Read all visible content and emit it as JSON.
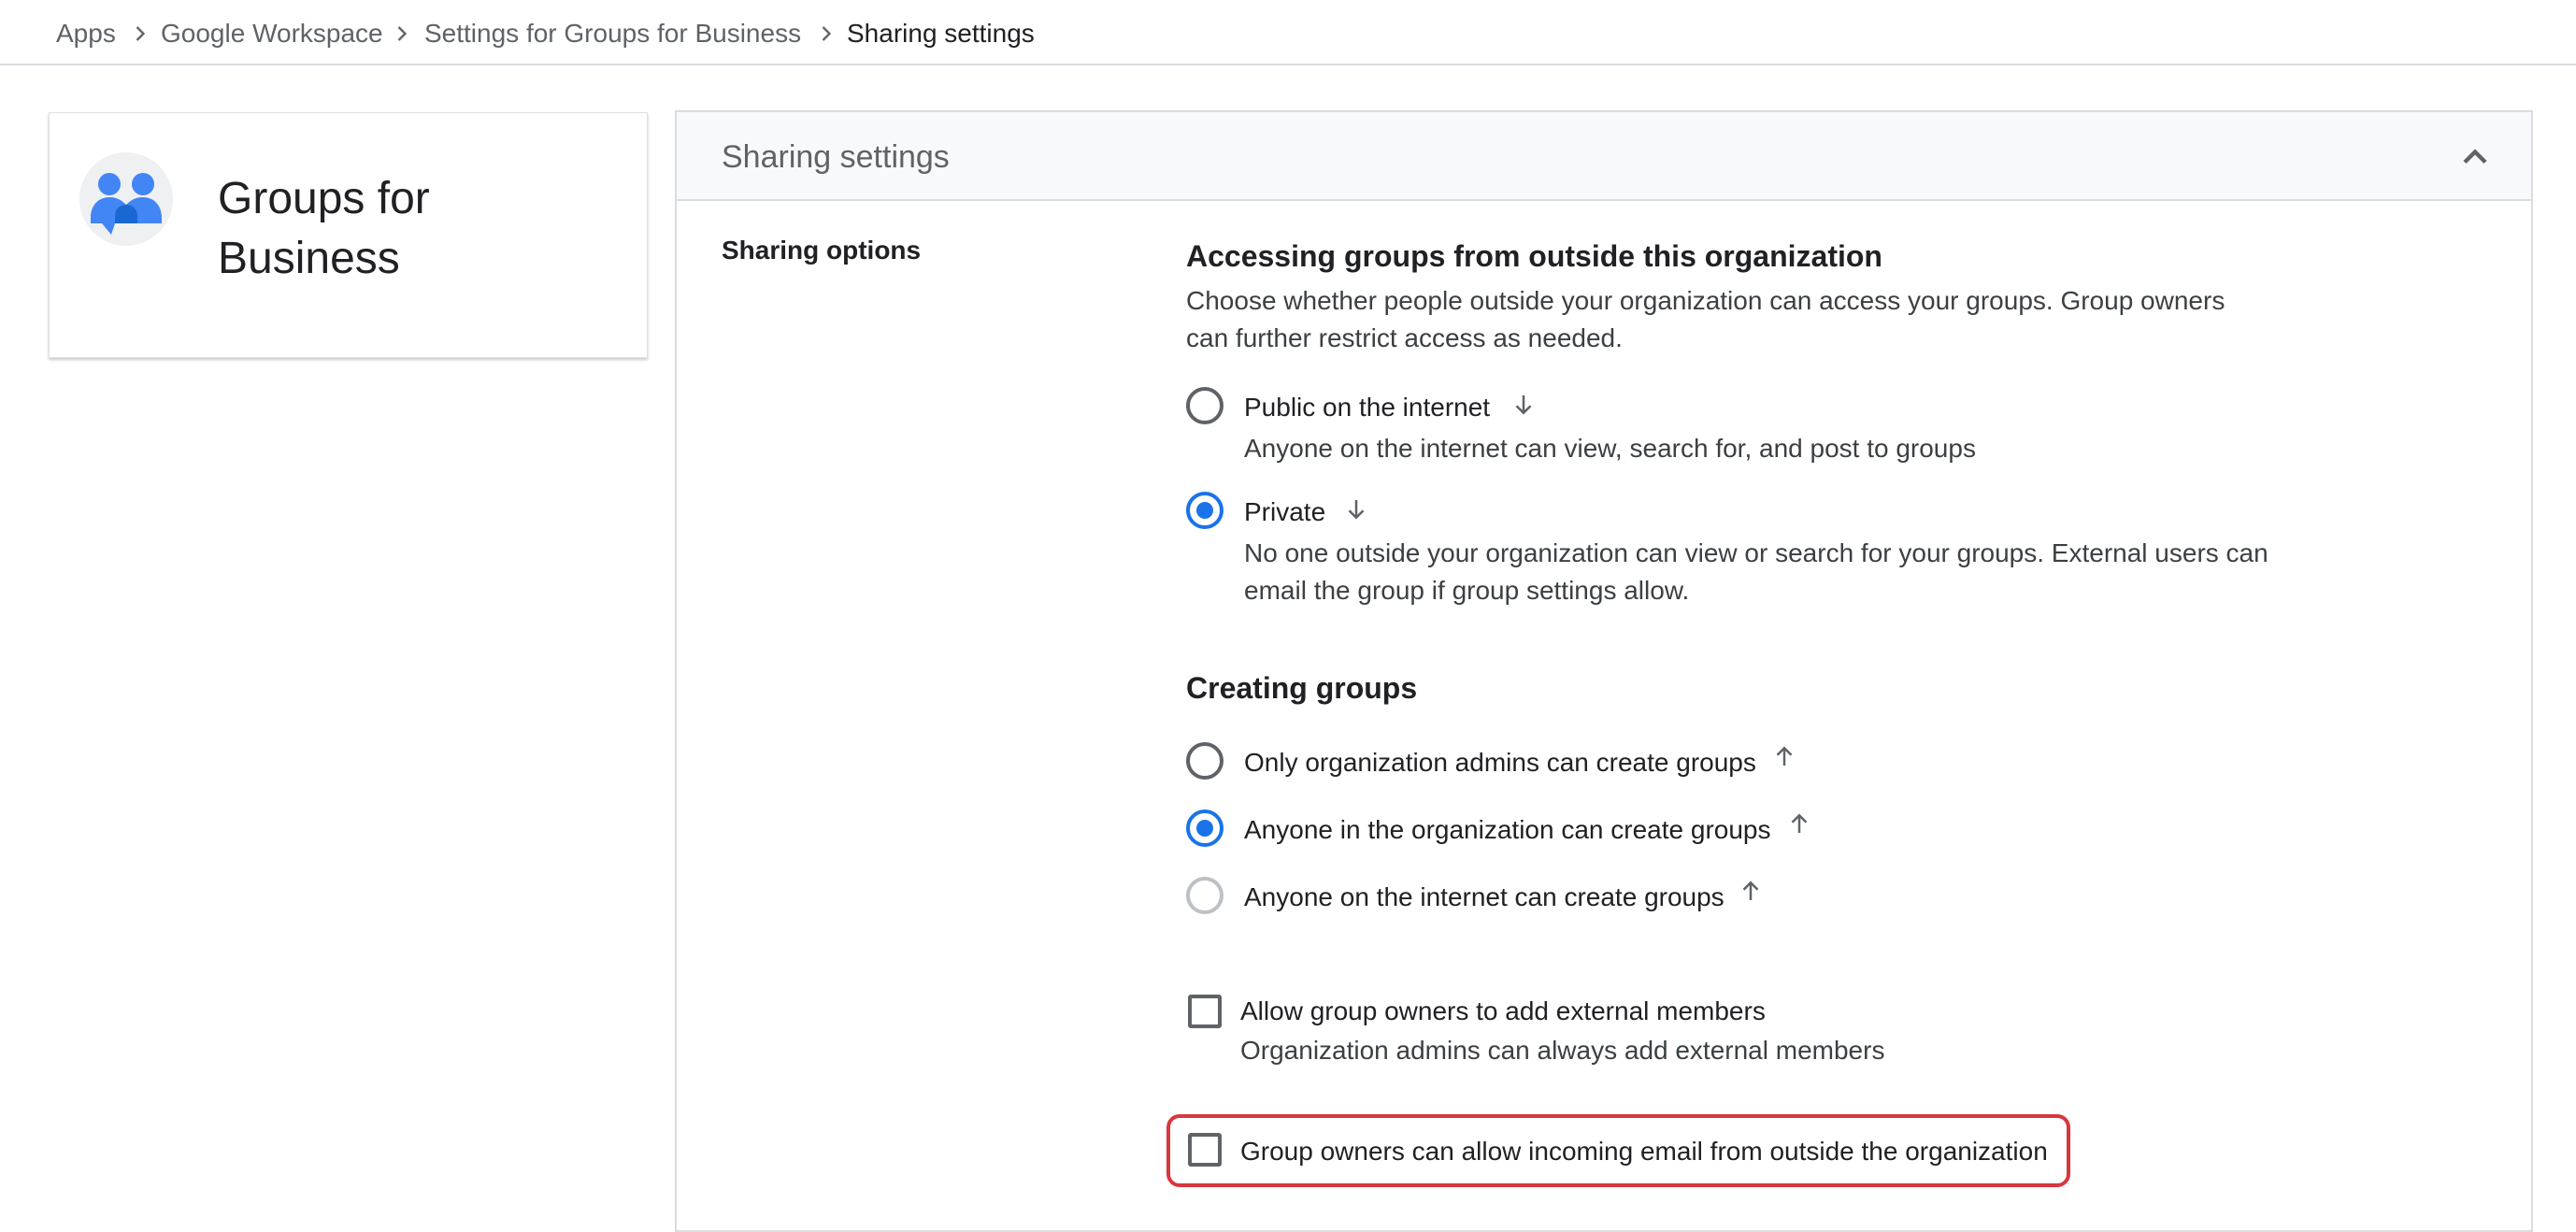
{
  "breadcrumb": {
    "items": [
      "Apps",
      "Google Workspace",
      "Settings for Groups for Business"
    ],
    "current": "Sharing settings"
  },
  "app_card": {
    "title_line1": "Groups for",
    "title_line2": "Business",
    "logo_icon": "groups-people-icon"
  },
  "panel": {
    "title": "Sharing settings",
    "collapse_icon": "chevron-up-icon",
    "side_label": "Sharing options"
  },
  "accessing": {
    "title": "Accessing groups from outside this organization",
    "description": "Choose whether people outside your organization can access your groups. Group owners can further restrict access as needed.",
    "options": [
      {
        "label": "Public on the internet",
        "sub": "Anyone on the internet can view, search for, and post to groups",
        "selected": false,
        "arrow_icon": "arrow-down-icon"
      },
      {
        "label": "Private",
        "sub": "No one outside your organization can view or search for your groups. External users can email the group if group settings allow.",
        "selected": true,
        "arrow_icon": "arrow-down-icon"
      }
    ]
  },
  "creating": {
    "title": "Creating groups",
    "options": [
      {
        "label": "Only organization admins can create groups",
        "selected": false,
        "arrow_icon": "arrow-up-icon"
      },
      {
        "label": "Anyone in the organization can create groups",
        "selected": true,
        "arrow_icon": "arrow-up-icon"
      },
      {
        "label": "Anyone on the internet can create groups",
        "selected": false,
        "disabled": true,
        "arrow_icon": "arrow-up-icon"
      }
    ]
  },
  "external_members": {
    "label": "Allow group owners to add external members",
    "sub": "Organization admins can always add external members",
    "checked": false
  },
  "incoming_email": {
    "label": "Group owners can allow incoming email from outside the organization",
    "checked": false,
    "highlight_color": "#d9363e"
  },
  "colors": {
    "accent": "#1a73e8",
    "text": "#202124",
    "secondary_text": "#5f6368",
    "border": "#dadce0",
    "highlight": "#d9363e"
  }
}
